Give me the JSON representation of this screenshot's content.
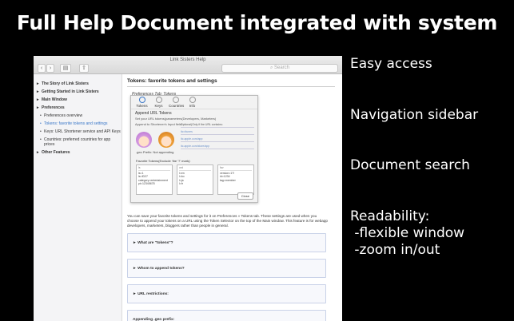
{
  "headline": "Full Help Document integrated with system",
  "features": [
    "Easy access",
    "Navigation sidebar",
    "Document search",
    "Readability:",
    " -flexible window",
    " -zoom in/out"
  ],
  "window": {
    "title": "Link Sisters Help",
    "back": "‹",
    "forward": "›",
    "sidebar_toggle": "▤",
    "share": "⇧",
    "search_placeholder": "Search"
  },
  "sidebar": {
    "items": [
      {
        "label": "The Story of Link Sisters",
        "bold": true,
        "sub": false
      },
      {
        "label": "Getting Started in Link Sisters",
        "bold": true,
        "sub": false
      },
      {
        "label": "Main Window",
        "bold": true,
        "sub": false
      },
      {
        "label": "Preferences",
        "bold": true,
        "sub": false
      },
      {
        "label": "Preferences overview",
        "bold": false,
        "sub": true
      },
      {
        "label": "Tokens: favorite tokens and settings",
        "bold": false,
        "sub": true,
        "active": true
      },
      {
        "label": "Keys: URL Shortener service and API Keys",
        "bold": false,
        "sub": true
      },
      {
        "label": "Countries: preferred countries for app prices",
        "bold": false,
        "sub": true
      },
      {
        "label": "Other Features",
        "bold": true,
        "sub": false
      }
    ]
  },
  "content": {
    "title": "Tokens: favorite tokens and settings",
    "pref_tab": "Preferences Tab: Tokens",
    "dialog": {
      "tabs": [
        "Tokens",
        "Keys",
        "Countries",
        "Info"
      ],
      "heading": "Append URL Tokens",
      "sub": "Set your URL tokens(parameters(Developers, Marketers)",
      "append_to": "Append to Shortener's Input field:",
      "options_title": "Optional(Only if the URL contains:",
      "options": [
        "itc=itunes",
        "itc.apple.com/app",
        "itc.apple.com/store/app"
      ],
      "geo": ".geo Prefix: Not appending",
      "fav_label": "Favorite Tokens(Exclude 'the '?' mark):",
      "fav_cols": [
        {
          "head": "ls",
          "rows": [
            "ls=1",
            "ls=ID27",
            "category=entertainment",
            "pt=12345678"
          ]
        },
        {
          "head": "ord",
          "rows": [
            "l=en",
            "l=ko",
            "l=ja",
            "l=fr"
          ]
        },
        {
          "head": "fav",
          "rows": [
            "version=1?!",
            "id=1234",
            "tag=member"
          ]
        }
      ],
      "close": "Close"
    },
    "paragraph": "You can save your favorite tokens and settings for it on Preferences » Tokens tab. These settings are used when you choose to append your tokens on a URL using the Token Selector on the top of the Main window. This feature is for webapp developers, marketers, bloggers rather than people in general.",
    "accordions": [
      "► What are \"tokens\"?",
      "► Whom to append tokens?",
      "► URL restrictions:",
      "Appending .geo prefix:"
    ]
  }
}
